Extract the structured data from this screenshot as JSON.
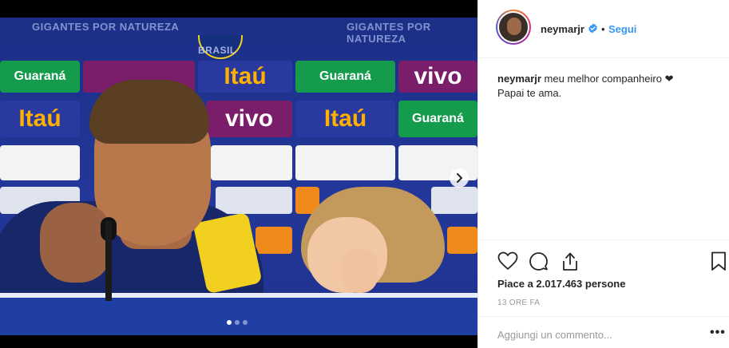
{
  "post": {
    "photo_alt_texts": {
      "wall_text_left": "GIGANTES POR NATUREZA",
      "wall_text_right": "GIGANTES POR NATUREZA",
      "wall_brand": "BRASIL",
      "sponsor_guarana": "Guaraná",
      "sponsor_itau": "Itaú",
      "sponsor_vivo": "vivo"
    },
    "carousel": {
      "total": 3,
      "active": 1
    }
  },
  "header": {
    "username": "neymarjr",
    "bullet": "•",
    "follow_label": "Segui"
  },
  "caption": {
    "username": "neymarjr",
    "line1": "meu melhor companheiro ❤",
    "line2": "Papai te ama."
  },
  "stats": {
    "likes": "Piace a 2.017.463 persone",
    "time": "13 ORE FA"
  },
  "comment": {
    "placeholder": "Aggiungi un commento...",
    "more": "•••"
  },
  "icons": [
    "heart-icon",
    "comment-icon",
    "share-icon",
    "bookmark-icon",
    "verified-icon",
    "chevron-right-icon"
  ],
  "colors": {
    "link": "#3897f0",
    "verified": "#3897f0",
    "text": "#262626",
    "muted": "#999999"
  }
}
